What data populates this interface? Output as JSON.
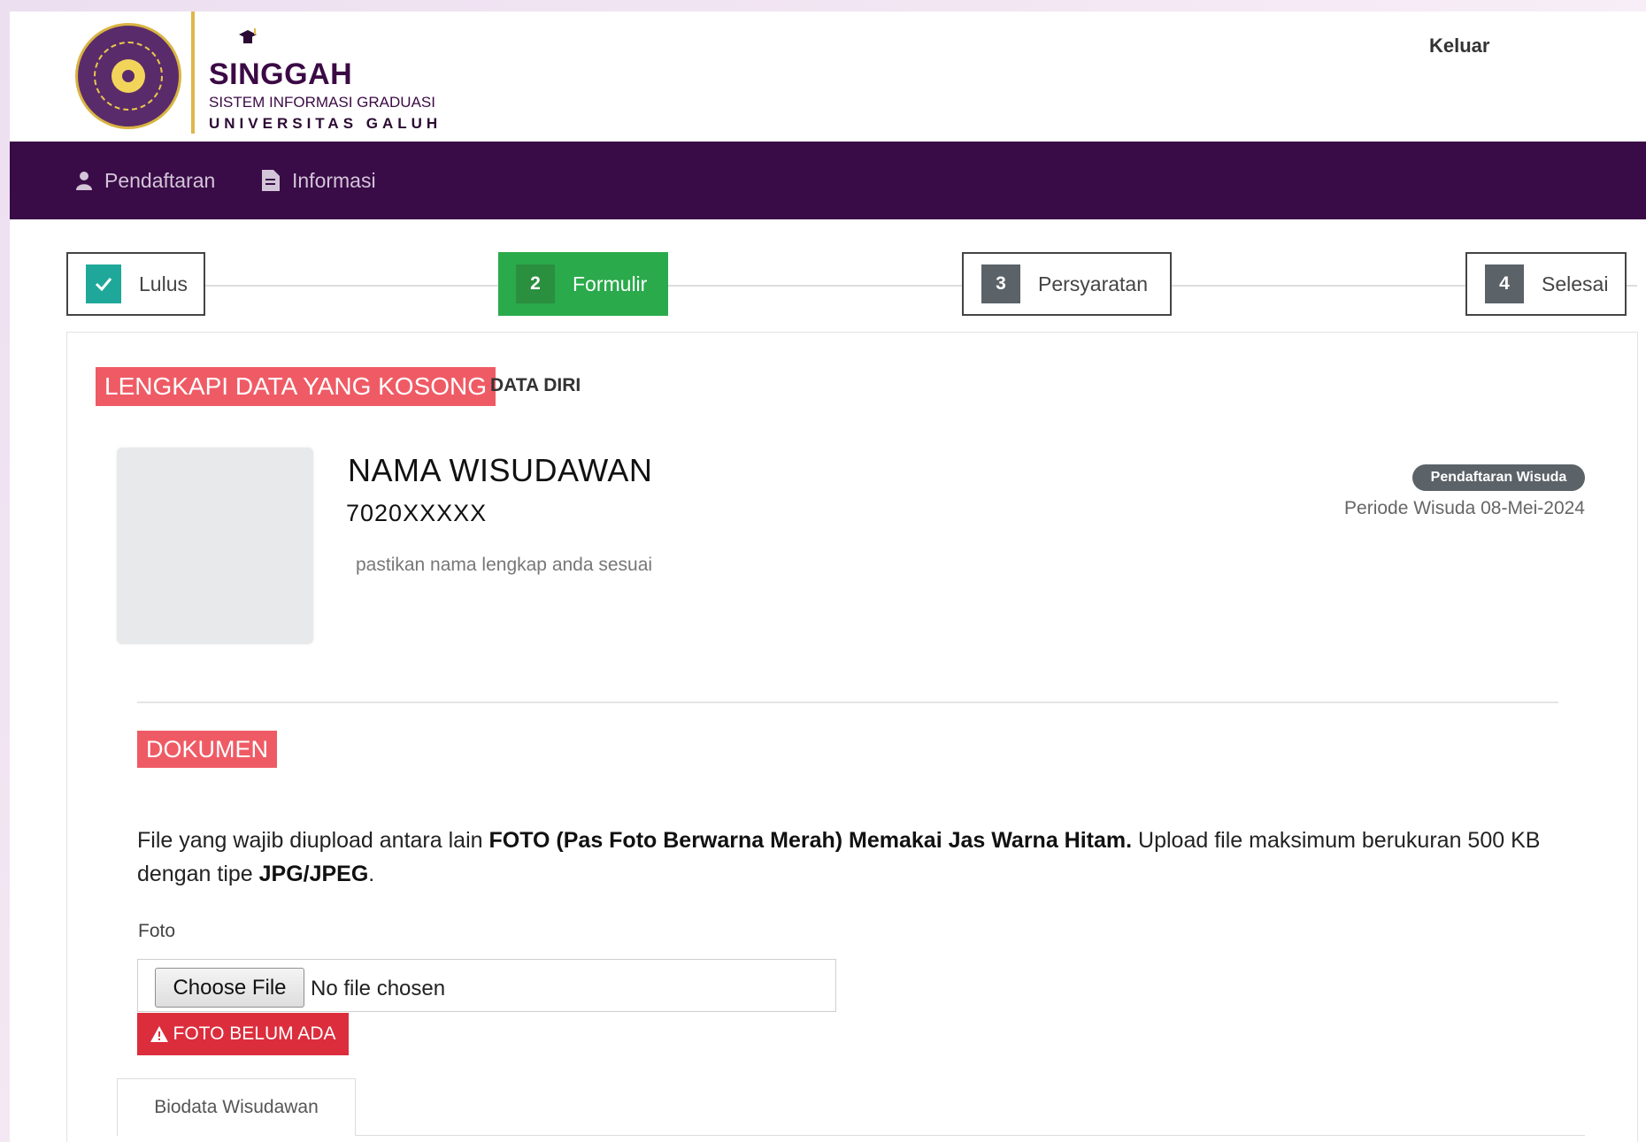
{
  "header": {
    "brand_title": "SINGGAH",
    "brand_subtitle": "SISTEM INFORMASI GRADUASI",
    "brand_university": "UNIVERSITAS GALUH",
    "logout_label": "Keluar"
  },
  "nav": {
    "items": [
      {
        "label": "Pendaftaran",
        "icon": "user-icon"
      },
      {
        "label": "Informasi",
        "icon": "document-icon"
      }
    ],
    "color": "#390b47"
  },
  "stepper": {
    "steps": [
      {
        "number": "",
        "label": "Lulus",
        "state": "done",
        "icon": "check-icon"
      },
      {
        "number": "2",
        "label": "Formulir",
        "state": "active"
      },
      {
        "number": "3",
        "label": "Persyaratan",
        "state": "pending"
      },
      {
        "number": "4",
        "label": "Selesai",
        "state": "pending"
      }
    ],
    "colors": {
      "done": "#1fa89a",
      "active": "#2aaa4b",
      "pending": "#5b6268"
    }
  },
  "profile": {
    "alert_label": "LENGKAPI DATA YANG KOSONG",
    "section_label": "DATA DIRI",
    "name": "NAMA WISUDAWAN",
    "nim": "7020XXXXX",
    "hint": "pastikan nama lengkap anda sesuai",
    "badge": "Pendaftaran Wisuda",
    "period": "Periode Wisuda 08-Mei-2024"
  },
  "documents": {
    "section_label": "DOKUMEN",
    "desc_1": "File yang wajib diupload antara lain ",
    "desc_bold_1": "FOTO (Pas Foto Berwarna Merah) Memakai Jas Warna Hitam.",
    "desc_2": " Upload file maksimum berukuran 500 KB dengan tipe ",
    "desc_bold_2": "JPG/JPEG",
    "desc_3": ".",
    "foto_label": "Foto",
    "choose_file_label": "Choose File",
    "no_file_text": "No file chosen",
    "missing_alert": "FOTO BELUM ADA"
  },
  "tabs": {
    "biodata_label": "Biodata Wisudawan"
  },
  "colors": {
    "badge_red": "#ef5b65",
    "alert_red": "#dc2d3c"
  }
}
